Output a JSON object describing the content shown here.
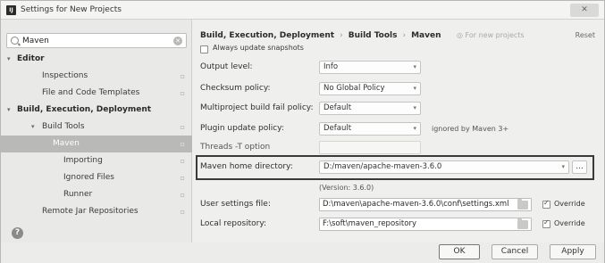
{
  "window": {
    "title": "Settings for New Projects",
    "app_icon": "IJ",
    "close_label": "✕"
  },
  "search": {
    "value": "Maven"
  },
  "tree": [
    {
      "label": "Editor",
      "level": 0,
      "bold": true,
      "expanded": true
    },
    {
      "label": "Inspections",
      "level": 1
    },
    {
      "label": "File and Code Templates",
      "level": 1
    },
    {
      "label": "Build, Execution, Deployment",
      "level": 0,
      "bold": true,
      "expanded": true
    },
    {
      "label": "Build Tools",
      "level": 1,
      "expanded": true
    },
    {
      "label": "Maven",
      "level": 2,
      "selected": true
    },
    {
      "label": "Importing",
      "level": 3
    },
    {
      "label": "Ignored Files",
      "level": 3
    },
    {
      "label": "Runner",
      "level": 3
    },
    {
      "label": "Remote Jar Repositories",
      "level": 1
    }
  ],
  "breadcrumb": {
    "part1": "Build, Execution, Deployment",
    "part2": "Build Tools",
    "part3": "Maven",
    "sep": "›",
    "note": "For new projects",
    "reset": "Reset"
  },
  "settings": {
    "always_update_label": "Always update snapshots",
    "output_level_label": "Output level:",
    "output_level_value": "Info",
    "checksum_label": "Checksum policy:",
    "checksum_value": "No Global Policy",
    "multiproject_label": "Multiproject build fail policy:",
    "multiproject_value": "Default",
    "plugin_update_label": "Plugin update policy:",
    "plugin_update_value": "Default",
    "plugin_update_hint": "ignored by Maven 3+",
    "threads_label": "Threads -T option",
    "maven_home_label": "Maven home directory:",
    "maven_home_value": "D:/maven/apache-maven-3.6.0",
    "maven_version": "(Version: 3.6.0)",
    "user_settings_label": "User settings file:",
    "user_settings_value": "D:\\maven\\apache-maven-3.6.0\\conf\\settings.xml",
    "override_label": "Override",
    "local_repo_label": "Local repository:",
    "local_repo_value": "F:\\soft\\maven_repository",
    "local_override_label": "Override"
  },
  "footer": {
    "ok": "OK",
    "cancel": "Cancel",
    "apply": "Apply"
  },
  "icons": {
    "help": "?",
    "chevron": "▾",
    "expand": "⋁"
  }
}
